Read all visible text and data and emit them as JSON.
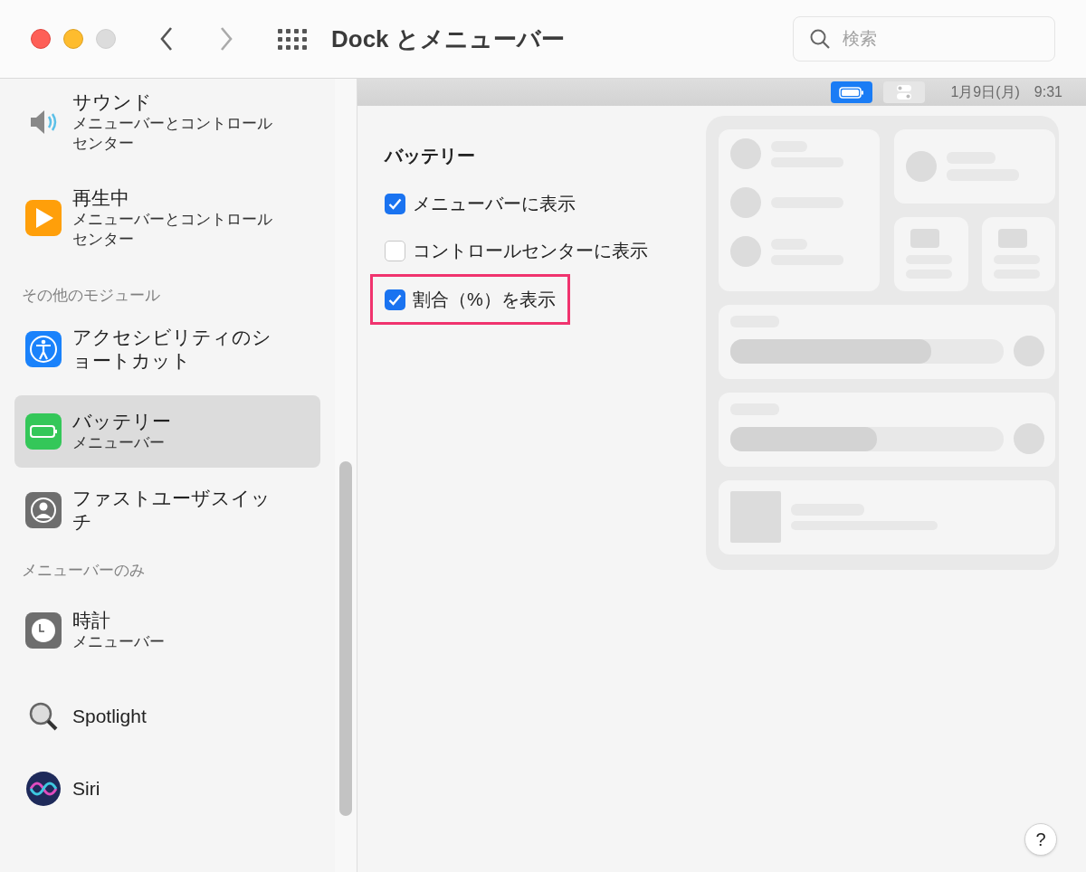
{
  "window": {
    "title": "Dock とメニューバー"
  },
  "search": {
    "placeholder": "検索"
  },
  "sidebar": {
    "items": [
      {
        "kind": "item",
        "title": "サウンド",
        "subtitle": "メニューバーとコントロールセンター",
        "selected": false
      },
      {
        "kind": "item",
        "title": "再生中",
        "subtitle": "メニューバーとコントロールセンター",
        "selected": false
      },
      {
        "kind": "heading",
        "title": "その他のモジュール"
      },
      {
        "kind": "item",
        "title": "アクセシビリティのショートカット",
        "selected": false
      },
      {
        "kind": "item",
        "title": "バッテリー",
        "subtitle": "メニューバー",
        "selected": true
      },
      {
        "kind": "item",
        "title": "ファストユーザスイッチ",
        "selected": false
      },
      {
        "kind": "heading",
        "title": "メニューバーのみ"
      },
      {
        "kind": "item",
        "title": "時計",
        "subtitle": "メニューバー",
        "selected": false
      },
      {
        "kind": "item",
        "title": "Spotlight",
        "selected": false
      },
      {
        "kind": "item",
        "title": "Siri",
        "selected": false
      }
    ]
  },
  "menubar_preview": {
    "items": [
      {
        "kind": "battery",
        "selected": true
      },
      {
        "kind": "control",
        "selected": false
      }
    ],
    "date": "1月9日(月)",
    "time": "9:31"
  },
  "section": {
    "title": "バッテリー",
    "options": [
      {
        "label": "メニューバーに表示",
        "checked": true,
        "highlighted": false
      },
      {
        "label": "コントロールセンターに表示",
        "checked": false,
        "highlighted": false
      },
      {
        "label": "割合（%）を表示",
        "checked": true,
        "highlighted": true
      }
    ]
  },
  "help": {
    "label": "?"
  }
}
